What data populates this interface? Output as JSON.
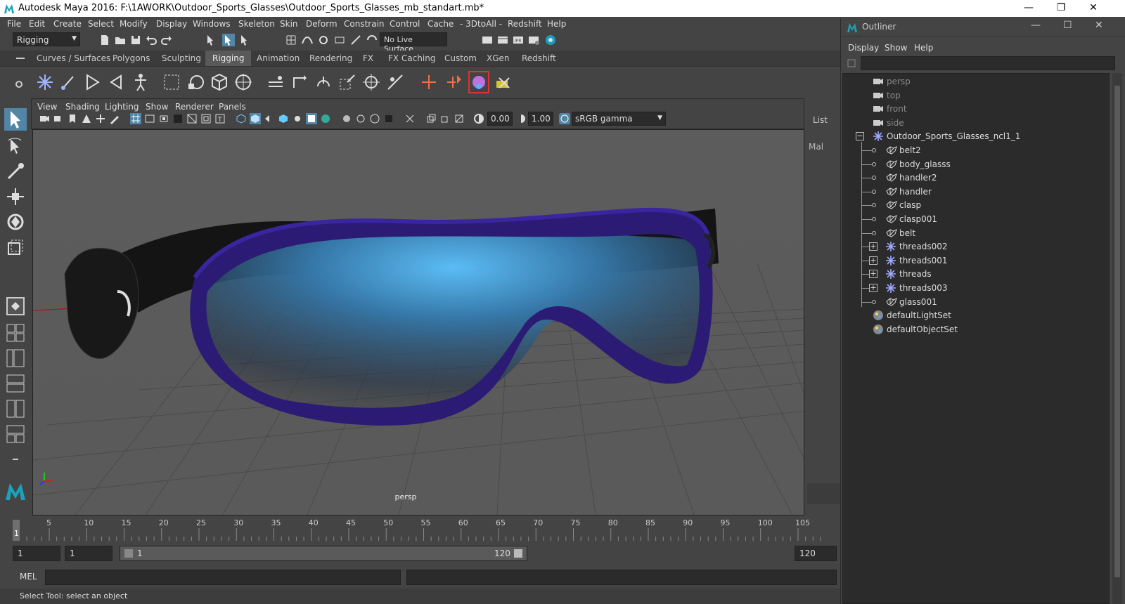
{
  "window": {
    "title": "Autodesk Maya 2016: F:\\1AWORK\\Outdoor_Sports_Glasses\\Outdoor_Sports_Glasses_mb_standart.mb*"
  },
  "menu": [
    "File",
    "Edit",
    "Create",
    "Select",
    "Modify",
    "Display",
    "Windows",
    "Skeleton",
    "Skin",
    "Deform",
    "Constrain",
    "Control",
    "Cache",
    "- 3DtoAll -",
    "Redshift",
    "Help"
  ],
  "status": {
    "mode": "Rigging",
    "live_surface": "No Live Surface"
  },
  "shelf_tabs": [
    "Curves / Surfaces",
    "Polygons",
    "Sculpting",
    "Rigging",
    "Animation",
    "Rendering",
    "FX",
    "FX Caching",
    "Custom",
    "XGen",
    "Redshift"
  ],
  "shelf_active": "Rigging",
  "panel_menu": [
    "View",
    "Shading",
    "Lighting",
    "Show",
    "Renderer",
    "Panels"
  ],
  "panel_values": {
    "exposure": "0.00",
    "gamma": "1.00",
    "color_space": "sRGB gamma"
  },
  "viewport": {
    "camera_label": "persp"
  },
  "channel_box": {
    "list": "List",
    "mal": "Mal"
  },
  "timeline": {
    "ticks": [
      "5",
      "10",
      "15",
      "20",
      "25",
      "30",
      "35",
      "40",
      "45",
      "50",
      "55",
      "60",
      "65",
      "70",
      "75",
      "80",
      "85",
      "90",
      "95",
      "100",
      "105"
    ],
    "current_frame": "1"
  },
  "range": {
    "start": "1",
    "start2": "1",
    "slider_start": "1",
    "slider_end": "120",
    "end": "120"
  },
  "cmd": {
    "label": "MEL"
  },
  "help_line": "Select Tool: select an object",
  "outliner": {
    "title": "Outliner",
    "menu": [
      "Display",
      "Show",
      "Help"
    ],
    "items": [
      {
        "label": "persp",
        "type": "camera",
        "level": 0
      },
      {
        "label": "top",
        "type": "camera",
        "level": 0
      },
      {
        "label": "front",
        "type": "camera",
        "level": 0
      },
      {
        "label": "side",
        "type": "camera",
        "level": 0
      },
      {
        "label": "Outdoor_Sports_Glasses_ncl1_1",
        "type": "group",
        "level": 0,
        "expander": "minus"
      },
      {
        "label": "belt2",
        "type": "mesh",
        "level": 1
      },
      {
        "label": "body_glasss",
        "type": "mesh",
        "level": 1
      },
      {
        "label": "handler2",
        "type": "mesh",
        "level": 1
      },
      {
        "label": "handler",
        "type": "mesh",
        "level": 1
      },
      {
        "label": "clasp",
        "type": "mesh",
        "level": 1
      },
      {
        "label": "clasp001",
        "type": "mesh",
        "level": 1
      },
      {
        "label": "belt",
        "type": "mesh",
        "level": 1
      },
      {
        "label": "threads002",
        "type": "group",
        "level": 1,
        "expander": "plus"
      },
      {
        "label": "threads001",
        "type": "group",
        "level": 1,
        "expander": "plus"
      },
      {
        "label": "threads",
        "type": "group",
        "level": 1,
        "expander": "plus"
      },
      {
        "label": "threads003",
        "type": "group",
        "level": 1,
        "expander": "plus"
      },
      {
        "label": "glass001",
        "type": "mesh",
        "level": 1
      },
      {
        "label": "defaultLightSet",
        "type": "set",
        "level": 0
      },
      {
        "label": "defaultObjectSet",
        "type": "set",
        "level": 0
      }
    ]
  }
}
